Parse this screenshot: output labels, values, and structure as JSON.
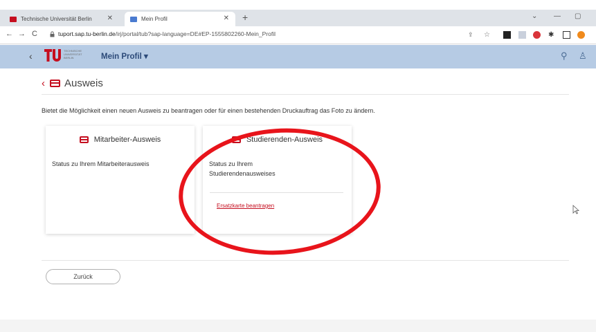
{
  "browser": {
    "tabs": [
      {
        "title": "Technische Universität Berlin",
        "active": false
      },
      {
        "title": "Mein Profil",
        "active": true
      }
    ],
    "url_prefix": "tuport.sap.tu-berlin.de",
    "url_rest": "/irj/portal/tub?sap-language=DE#EP-1555802260-Mein_Profil"
  },
  "app": {
    "logo_text": "TECHNISCHE UNIVERSITÄT BERLIN",
    "profile_menu": "Mein Profil ▾"
  },
  "page": {
    "title": "Ausweis",
    "description": "Bietet die Möglichkeit einen neuen Ausweis zu beantragen oder für einen bestehenden Druckauftrag das Foto zu ändern.",
    "tiles": [
      {
        "title": "Mitarbeiter-Ausweis",
        "status": "Status zu Ihrem Mitarbeiterausweis"
      },
      {
        "title": "Studierenden-Ausweis",
        "status": "Status zu Ihrem Studierendenausweises",
        "link": "Ersatzkarte beantragen"
      }
    ],
    "back_button": "Zurück"
  },
  "colors": {
    "accent": "#c50e1f",
    "header_bg": "#b6cbe4",
    "annotation": "#e8141b"
  }
}
